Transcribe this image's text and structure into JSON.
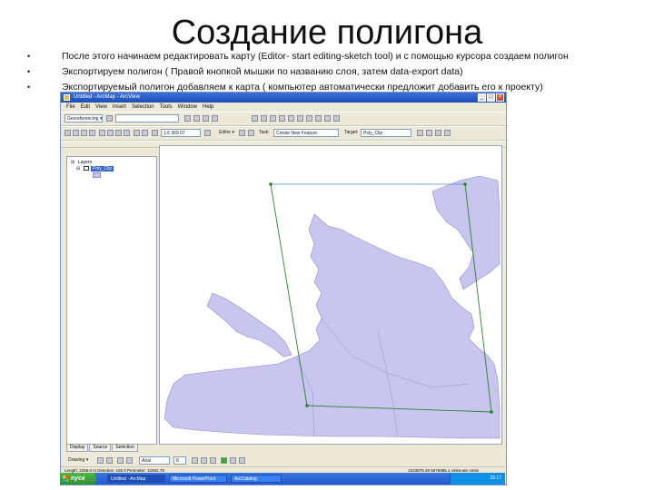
{
  "slide": {
    "title": "Создание полигона",
    "bullets": [
      "После этого начинаем редактировать карту (Editor- start editing-sketch tool) и с помощью курсора создаем полигон",
      "Экспортируем полигон ( Правой кнопкой мышки по названию слоя, затем data-export data)",
      "Экспортируемый полигон добавляем к карта ( компьютер автоматически предложит добавить его к проекту)"
    ],
    "bullet_glyph": "•"
  },
  "app": {
    "title": "Untitled - ArcMap - ArcView",
    "menu": [
      "File",
      "Edit",
      "View",
      "Insert",
      "Selection",
      "Tools",
      "Window",
      "Help"
    ],
    "toolbar1": {
      "georef_label": "Georeferencing ▾"
    },
    "toolbar2": {
      "scale_value": "1:6 369 07",
      "editor_label": "Editor ▾",
      "task_label": "Task:",
      "task_value": "Create New Feature",
      "target_label": "Target:",
      "target_value": "Poly_Clip"
    },
    "toc": {
      "root": "Layers",
      "layer": "Poly_Clip",
      "tabs": [
        "Display",
        "Source",
        "Selection"
      ]
    },
    "draw_bar": {
      "drawing_label": "Drawing ▾",
      "font_value": "Arial",
      "size_value": "8"
    },
    "status": {
      "left": "Length: 2256.0 m  Direction: 106.0  Perimeter: 10263.78",
      "right": "2343875.49  5075985.1  Unknown Units"
    }
  },
  "taskbar": {
    "start_label": "пуск",
    "items": [
      "Untitled - ArcMap",
      "Microsoft PowerPoint",
      "ArcCatalog"
    ],
    "clock": "15:17"
  },
  "colors": {
    "land": "#c8c5ee",
    "land_stroke": "#8f8bc7",
    "sketch_line": "#2e7d32",
    "selection": "#4a8bc4"
  }
}
